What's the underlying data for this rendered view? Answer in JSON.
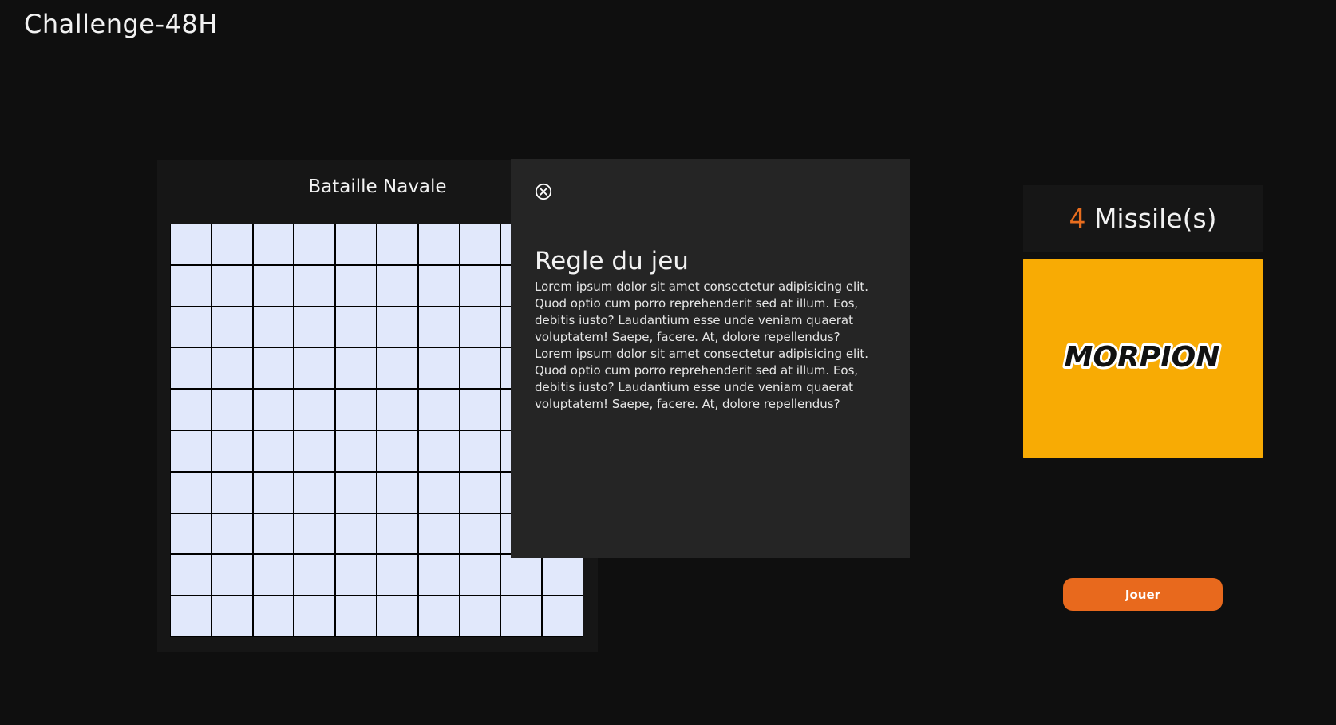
{
  "header": {
    "title": "Challenge-48H"
  },
  "board": {
    "title": "Bataille Navale",
    "rows": 10,
    "cols": 10,
    "cell_color": "#e1e8fb"
  },
  "rules_modal": {
    "close_icon": "close-circle-icon",
    "title": "Regle du jeu",
    "paragraphs": [
      "Lorem ipsum dolor sit amet consectetur adipisicing elit. Quod optio cum porro reprehenderit sed at illum. Eos, debitis iusto? Laudantium esse unde veniam quaerat voluptatem! Saepe, facere. At, dolore repellendus?",
      "Lorem ipsum dolor sit amet consectetur adipisicing elit. Quod optio cum porro reprehenderit sed at illum. Eos, debitis iusto? Laudantium esse unde veniam quaerat voluptatem! Saepe, facere. At, dolore repellendus?"
    ]
  },
  "sidebar": {
    "missiles_count": "4",
    "missiles_label": "Missile(s)",
    "game_card": {
      "logo_text": "MORPION",
      "background": "#f8ab04"
    },
    "play_label": "Jouer"
  },
  "colors": {
    "background": "#0f0f0f",
    "panel": "#161616",
    "modal": "#252525",
    "accent": "#e8691d"
  }
}
